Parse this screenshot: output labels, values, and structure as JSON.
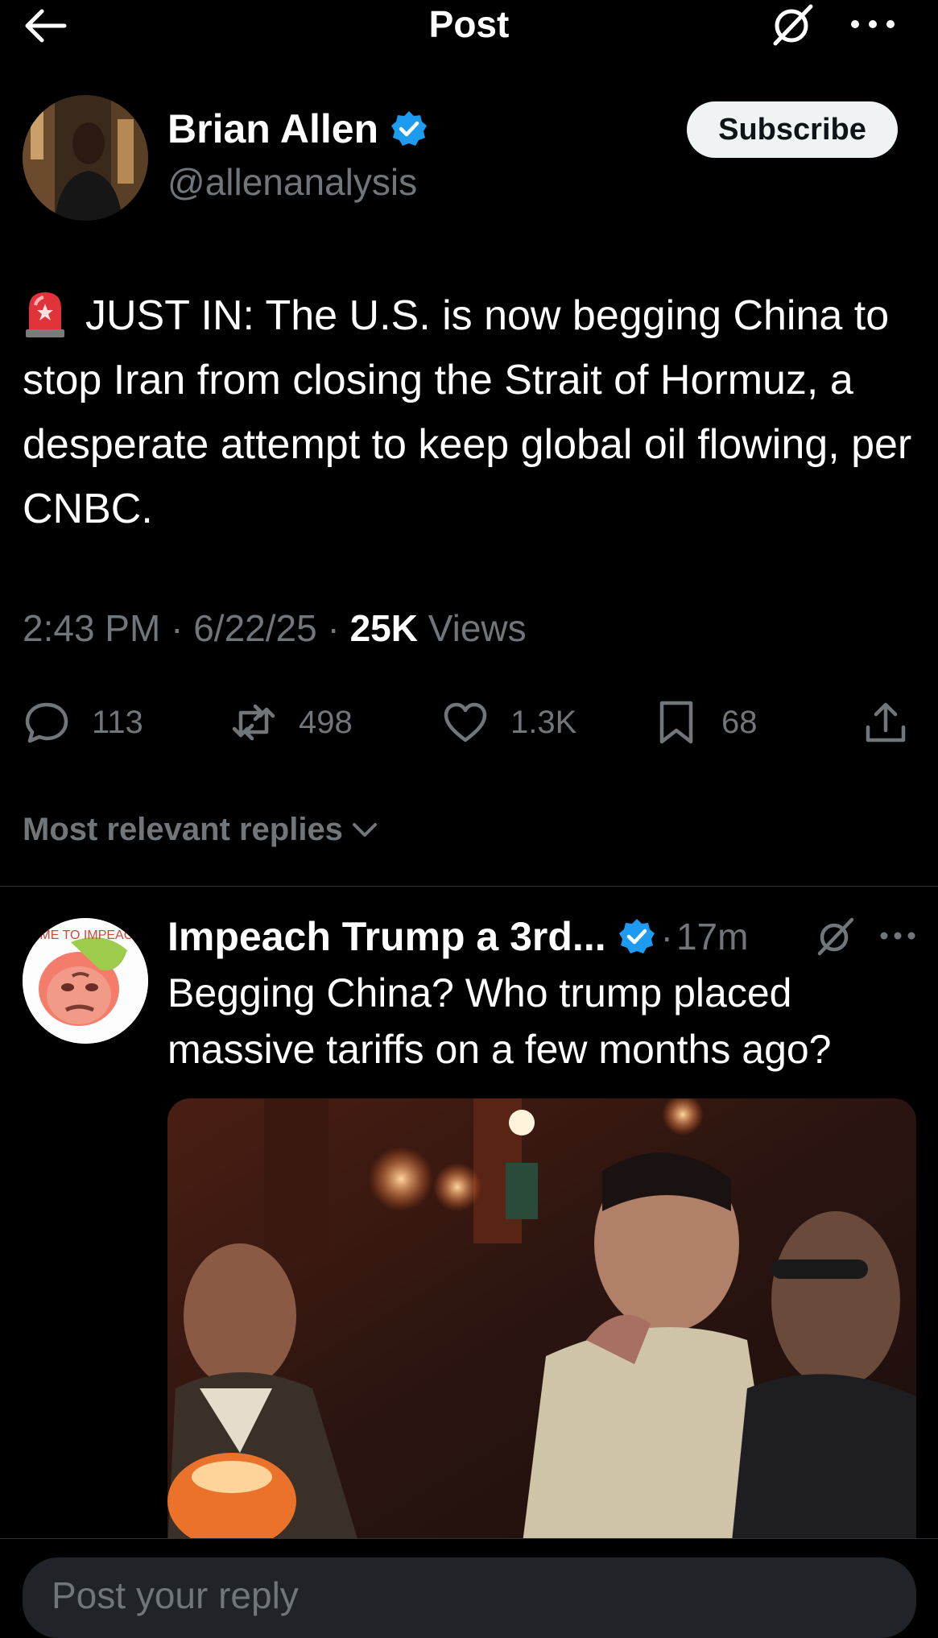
{
  "header": {
    "title": "Post"
  },
  "post": {
    "author_name": "Brian Allen",
    "author_handle": "@allenanalysis",
    "subscribe_label": "Subscribe",
    "text": "JUST IN: The U.S. is now begging China to stop Iran from closing the Strait of Hormuz, a desperate attempt to keep global oil flowing, per CNBC.",
    "time": "2:43 PM",
    "date": "6/22/25",
    "views_count": "25K",
    "views_label": "Views",
    "stats": {
      "replies": "113",
      "reposts": "498",
      "likes": "1.3K",
      "bookmarks": "68"
    }
  },
  "replies_sort_label": "Most relevant replies",
  "reply": {
    "author_name": "Impeach Trump a 3rd...",
    "time": "17m",
    "text": "Begging China? Who trump placed massive tariffs on a few months ago?",
    "avatar_text": "TIME TO IMPEACH"
  },
  "composer": {
    "placeholder": "Post your reply"
  },
  "colors": {
    "background": "#000000",
    "text": "#e7e9ea",
    "muted": "#71767b",
    "verified": "#1d9bf0",
    "divider": "#2f3336"
  }
}
